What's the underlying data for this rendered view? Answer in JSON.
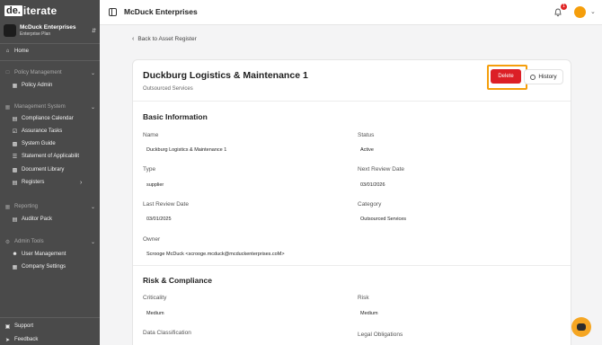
{
  "brand": {
    "logo_box": "de.",
    "logo_rest": "iterate"
  },
  "org": {
    "name": "McDuck Enterprises",
    "plan": "Enterprise Plan"
  },
  "sidebar": {
    "home": "Home",
    "policy_section": "Policy Management",
    "policy_admin": "Policy Admin",
    "management_section": "Management System",
    "compliance_calendar": "Compliance Calendar",
    "assurance_tasks": "Assurance Tasks",
    "system_guide": "System Guide",
    "statement": "Statement of Applicabilit",
    "document_library": "Document Library",
    "registers": "Registers",
    "reporting_section": "Reporting",
    "auditor_pack": "Auditor Pack",
    "admin_section": "Admin Tools",
    "user_management": "User Management",
    "company_settings": "Company Settings",
    "support": "Support",
    "feedback": "Feedback"
  },
  "topbar": {
    "title": "McDuck Enterprises",
    "notification_count": "1"
  },
  "main": {
    "back_label": "Back to Asset Register",
    "title": "Duckburg Logistics & Maintenance 1",
    "subtitle": "Outsourced Services",
    "delete_label": "Delete",
    "history_label": "History"
  },
  "basic": {
    "heading": "Basic Information",
    "name_label": "Name",
    "name_value": "Duckburg Logistics & Maintenance 1",
    "status_label": "Status",
    "status_value": "Active",
    "type_label": "Type",
    "type_value": "supplier",
    "next_review_label": "Next Review Date",
    "next_review_value": "03/01/2026",
    "last_review_label": "Last Review Date",
    "last_review_value": "03/01/2025",
    "category_label": "Category",
    "category_value": "Outsourced Services",
    "owner_label": "Owner",
    "owner_value": "Scrooge McDuck <scrooge.mcduck@mcduckenterprises.coM>"
  },
  "risk": {
    "heading": "Risk & Compliance",
    "criticality_label": "Criticality",
    "criticality_value": "Medium",
    "risk_label": "Risk",
    "risk_value": "Medium",
    "data_class_label": "Data Classification",
    "legal_label": "Legal Obligations"
  },
  "colors": {
    "accent": "#f59e0b",
    "danger": "#dc1f26",
    "sidebar": "#4a4a4a"
  }
}
